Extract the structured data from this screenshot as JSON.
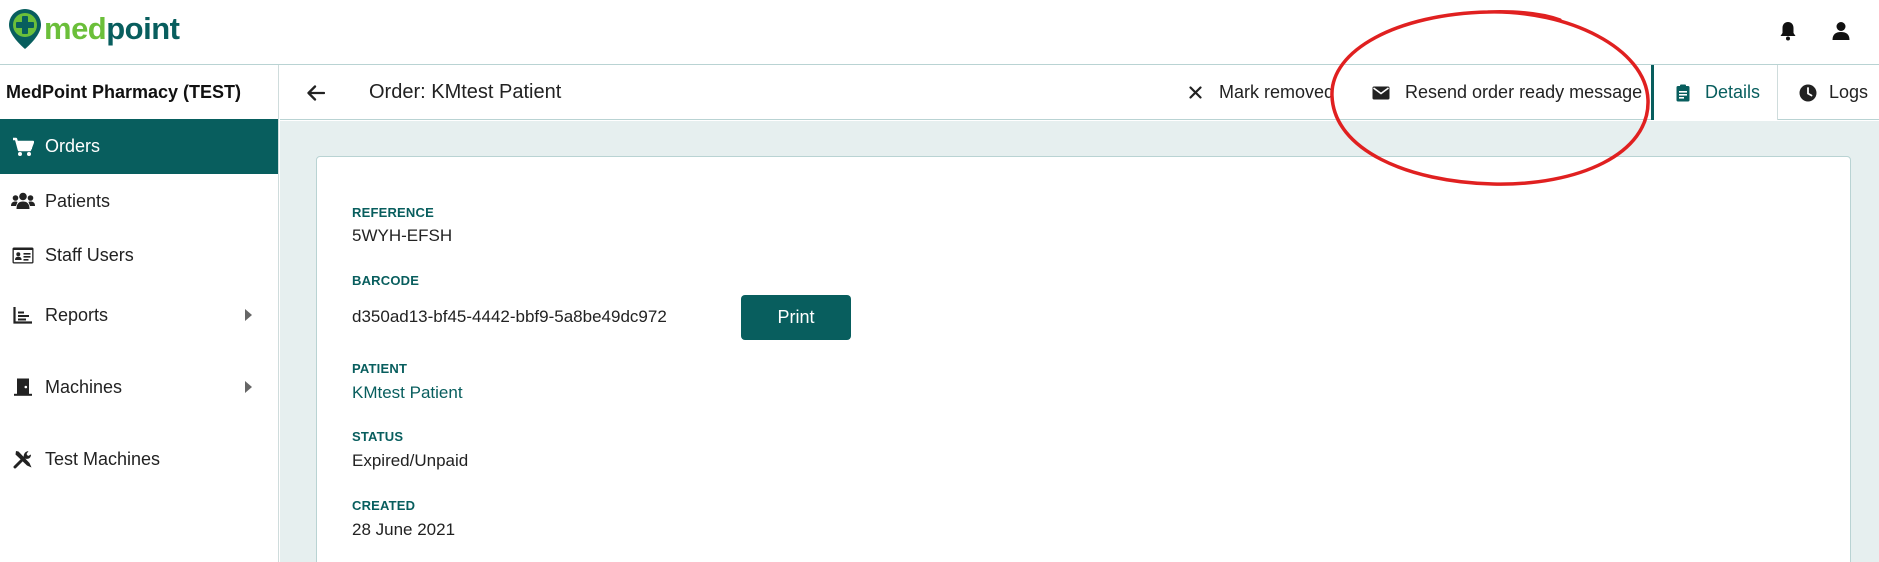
{
  "brand": {
    "logo_med": "med",
    "logo_point": "point"
  },
  "topbar": {
    "notifications_icon": "bell-icon",
    "user_icon": "user-icon"
  },
  "sidebar": {
    "pharmacy_name": "MedPoint Pharmacy (TEST)",
    "items": [
      {
        "label": "Orders",
        "icon": "cart-icon",
        "active": true
      },
      {
        "label": "Patients",
        "icon": "users-icon"
      },
      {
        "label": "Staff Users",
        "icon": "id-card-icon"
      },
      {
        "label": "Reports",
        "icon": "chart-icon",
        "expandable": true
      },
      {
        "label": "Machines",
        "icon": "door-icon",
        "expandable": true
      },
      {
        "label": "Test Machines",
        "icon": "tools-icon"
      }
    ]
  },
  "header": {
    "title": "Order: KMtest Patient",
    "mark_removed": "Mark removed",
    "resend": "Resend order ready message",
    "tab_details": "Details",
    "tab_logs": "Logs"
  },
  "order": {
    "reference_label": "REFERENCE",
    "reference": "5WYH-EFSH",
    "barcode_label": "BARCODE",
    "barcode": "d350ad13-bf45-4442-bbf9-5a8be49dc972",
    "print_label": "Print",
    "patient_label": "PATIENT",
    "patient": "KMtest Patient",
    "status_label": "STATUS",
    "status": "Expired/Unpaid",
    "created_label": "CREATED",
    "created": "28 June 2021"
  },
  "colors": {
    "primary": "#085e5e",
    "brand_green": "#6bbf3a",
    "content_bg": "#e6efef",
    "annotation": "#e02020"
  }
}
